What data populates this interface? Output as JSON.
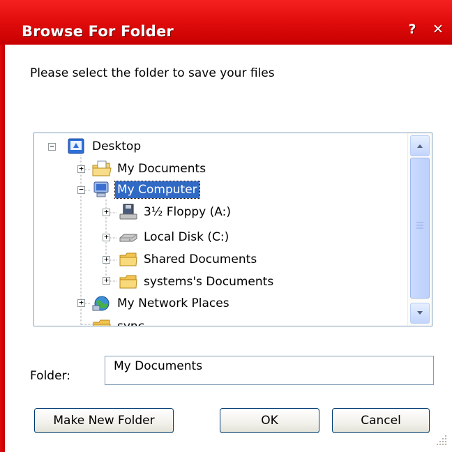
{
  "window": {
    "title": "Browse For Folder",
    "help_label": "?",
    "close_label": "✕"
  },
  "prompt": "Please select the folder to save your files",
  "tree": {
    "nodes": [
      {
        "label": "Desktop",
        "expanded": true,
        "icon": "desktop-icon"
      },
      {
        "label": "My Documents",
        "expanded": false,
        "icon": "my-documents-icon"
      },
      {
        "label": "My Computer",
        "expanded": true,
        "selected": true,
        "icon": "my-computer-icon"
      },
      {
        "label": "3½ Floppy (A:)",
        "expanded": false,
        "icon": "floppy-drive-icon"
      },
      {
        "label": "Local Disk (C:)",
        "expanded": false,
        "icon": "hard-disk-icon"
      },
      {
        "label": "Shared Documents",
        "expanded": false,
        "icon": "folder-icon"
      },
      {
        "label": "systems's Documents",
        "expanded": false,
        "icon": "folder-icon"
      },
      {
        "label": "My Network Places",
        "expanded": false,
        "icon": "network-places-icon"
      },
      {
        "label": "sync",
        "icon": "folder-icon"
      }
    ],
    "expander_collapsed": "+",
    "expander_expanded": "−"
  },
  "folder": {
    "label": "Folder:",
    "value": "My Documents"
  },
  "buttons": {
    "make_new_folder": "Make New Folder",
    "ok": "OK",
    "cancel": "Cancel"
  },
  "colors": {
    "titlebar": "#e00c0c",
    "selection": "#316ac5",
    "tree_border": "#7f9db9"
  }
}
